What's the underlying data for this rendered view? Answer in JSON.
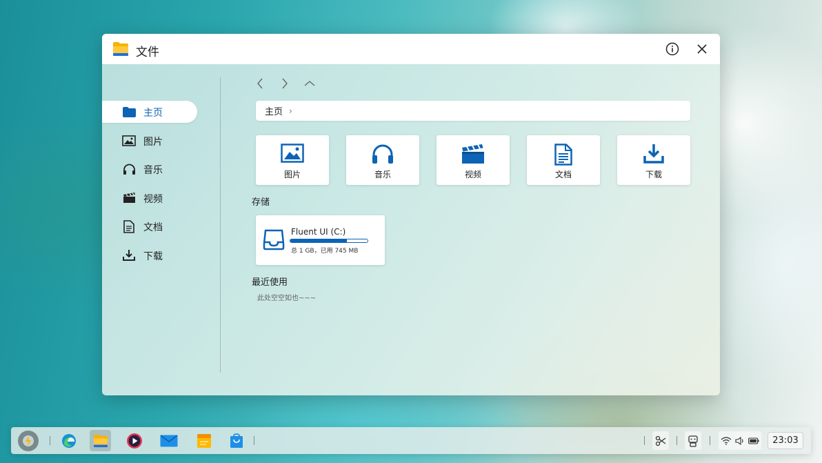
{
  "window": {
    "title": "文件",
    "icons": {
      "app": "folder-icon",
      "info": "info-icon",
      "close": "close-icon"
    }
  },
  "sidebar": {
    "items": [
      {
        "label": "主页",
        "icon": "folder-icon",
        "active": true
      },
      {
        "label": "图片",
        "icon": "image-icon",
        "active": false
      },
      {
        "label": "音乐",
        "icon": "headphones-icon",
        "active": false
      },
      {
        "label": "视频",
        "icon": "clapperboard-icon",
        "active": false
      },
      {
        "label": "文档",
        "icon": "document-icon",
        "active": false
      },
      {
        "label": "下载",
        "icon": "download-icon",
        "active": false
      }
    ]
  },
  "navigation": {
    "back": "chevron-left-icon",
    "forward": "chevron-right-icon",
    "up": "chevron-up-icon"
  },
  "address": {
    "crumb": "主页",
    "separator": "›"
  },
  "quick_access": [
    {
      "label": "图片",
      "icon": "image-icon"
    },
    {
      "label": "音乐",
      "icon": "headphones-icon"
    },
    {
      "label": "视频",
      "icon": "clapperboard-icon"
    },
    {
      "label": "文档",
      "icon": "document-icon"
    },
    {
      "label": "下载",
      "icon": "download-icon"
    }
  ],
  "storage": {
    "title": "存储",
    "drive": {
      "name": "Fluent UI  (C:)",
      "stats": "总 1 GB，已用 745 MB",
      "used_fraction": 0.73,
      "icon": "drive-icon"
    }
  },
  "recent": {
    "title": "最近使用",
    "empty_text": "此处空空如也~~~"
  },
  "taskbar": {
    "apps": [
      "edge-icon",
      "files-icon",
      "media-player-icon",
      "mail-icon",
      "notes-icon",
      "store-icon"
    ],
    "tray": [
      "scissors-icon",
      "robot-icon",
      "wifi-icon",
      "volume-icon",
      "battery-icon"
    ],
    "clock": "23:03"
  },
  "colors": {
    "accent": "#0d63b5",
    "folder": "#f5b400"
  }
}
